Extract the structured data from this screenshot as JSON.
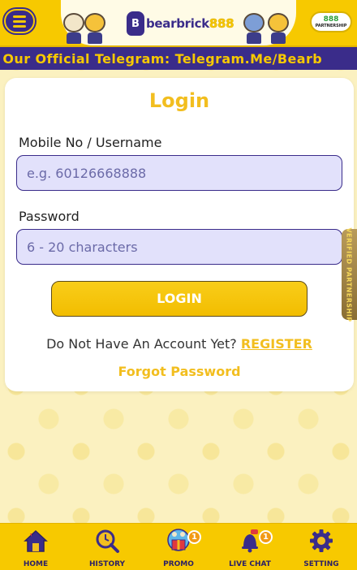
{
  "header": {
    "logo_mark": "B",
    "logo_text": "bearbrick",
    "logo_number": "888",
    "partner_number": "888",
    "partner_label": "PARTNERSHIP"
  },
  "marquee": {
    "text": "ugh Our Official Telegram: Telegram.Me/Bearb"
  },
  "login": {
    "title": "Login",
    "username_label": "Mobile No / Username",
    "username_placeholder": "e.g. 60126668888",
    "username_value": "",
    "password_label": "Password",
    "password_placeholder": "6 - 20 characters",
    "password_value": "",
    "login_button": "LOGIN",
    "no_account_text": "Do Not Have An Account Yet?",
    "register_link": "REGISTER",
    "forgot_password": "Forgot Password"
  },
  "side_tab": {
    "label": "VERIFIED PARTNERSHIP"
  },
  "bottom_nav": {
    "items": [
      {
        "label": "HOME",
        "icon": "home-icon"
      },
      {
        "label": "HISTORY",
        "icon": "history-search-icon"
      },
      {
        "label": "PROMO",
        "icon": "promo-gift-icon",
        "badge": "1"
      },
      {
        "label": "LIVE CHAT",
        "icon": "bell-chat-icon",
        "badge": "1"
      },
      {
        "label": "SETTING",
        "icon": "gear-icon"
      }
    ]
  },
  "colors": {
    "brand_yellow": "#f7c900",
    "brand_purple": "#3a2c8a",
    "accent_gold": "#f2be1f",
    "badge_orange": "#f29a14"
  }
}
